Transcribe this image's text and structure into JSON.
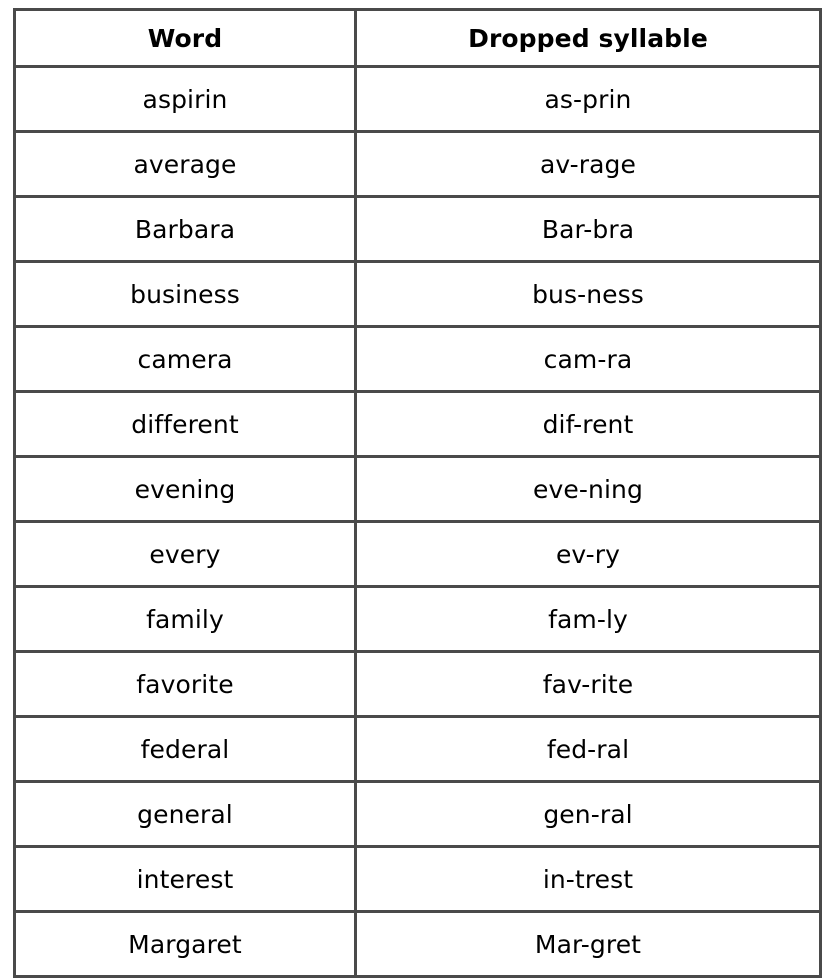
{
  "table": {
    "columns": [
      {
        "key": "word",
        "header": "Word"
      },
      {
        "key": "dropped",
        "header": "Dropped syllable"
      }
    ],
    "rows": [
      {
        "word": "aspirin",
        "dropped": "as-prin"
      },
      {
        "word": "average",
        "dropped": "av-rage"
      },
      {
        "word": "Barbara",
        "dropped": "Bar-bra"
      },
      {
        "word": "business",
        "dropped": "bus-ness"
      },
      {
        "word": "camera",
        "dropped": "cam-ra"
      },
      {
        "word": "different",
        "dropped": "dif-rent"
      },
      {
        "word": "evening",
        "dropped": "eve-ning"
      },
      {
        "word": "every",
        "dropped": "ev-ry"
      },
      {
        "word": "family",
        "dropped": "fam-ly"
      },
      {
        "word": "favorite",
        "dropped": "fav-rite"
      },
      {
        "word": "federal",
        "dropped": "fed-ral"
      },
      {
        "word": "general",
        "dropped": "gen-ral"
      },
      {
        "word": "interest",
        "dropped": "in-trest"
      },
      {
        "word": "Margaret",
        "dropped": "Mar-gret"
      }
    ]
  },
  "colors": {
    "background": "#ffffff",
    "border": "#4a4a4a",
    "text": "#000000"
  }
}
